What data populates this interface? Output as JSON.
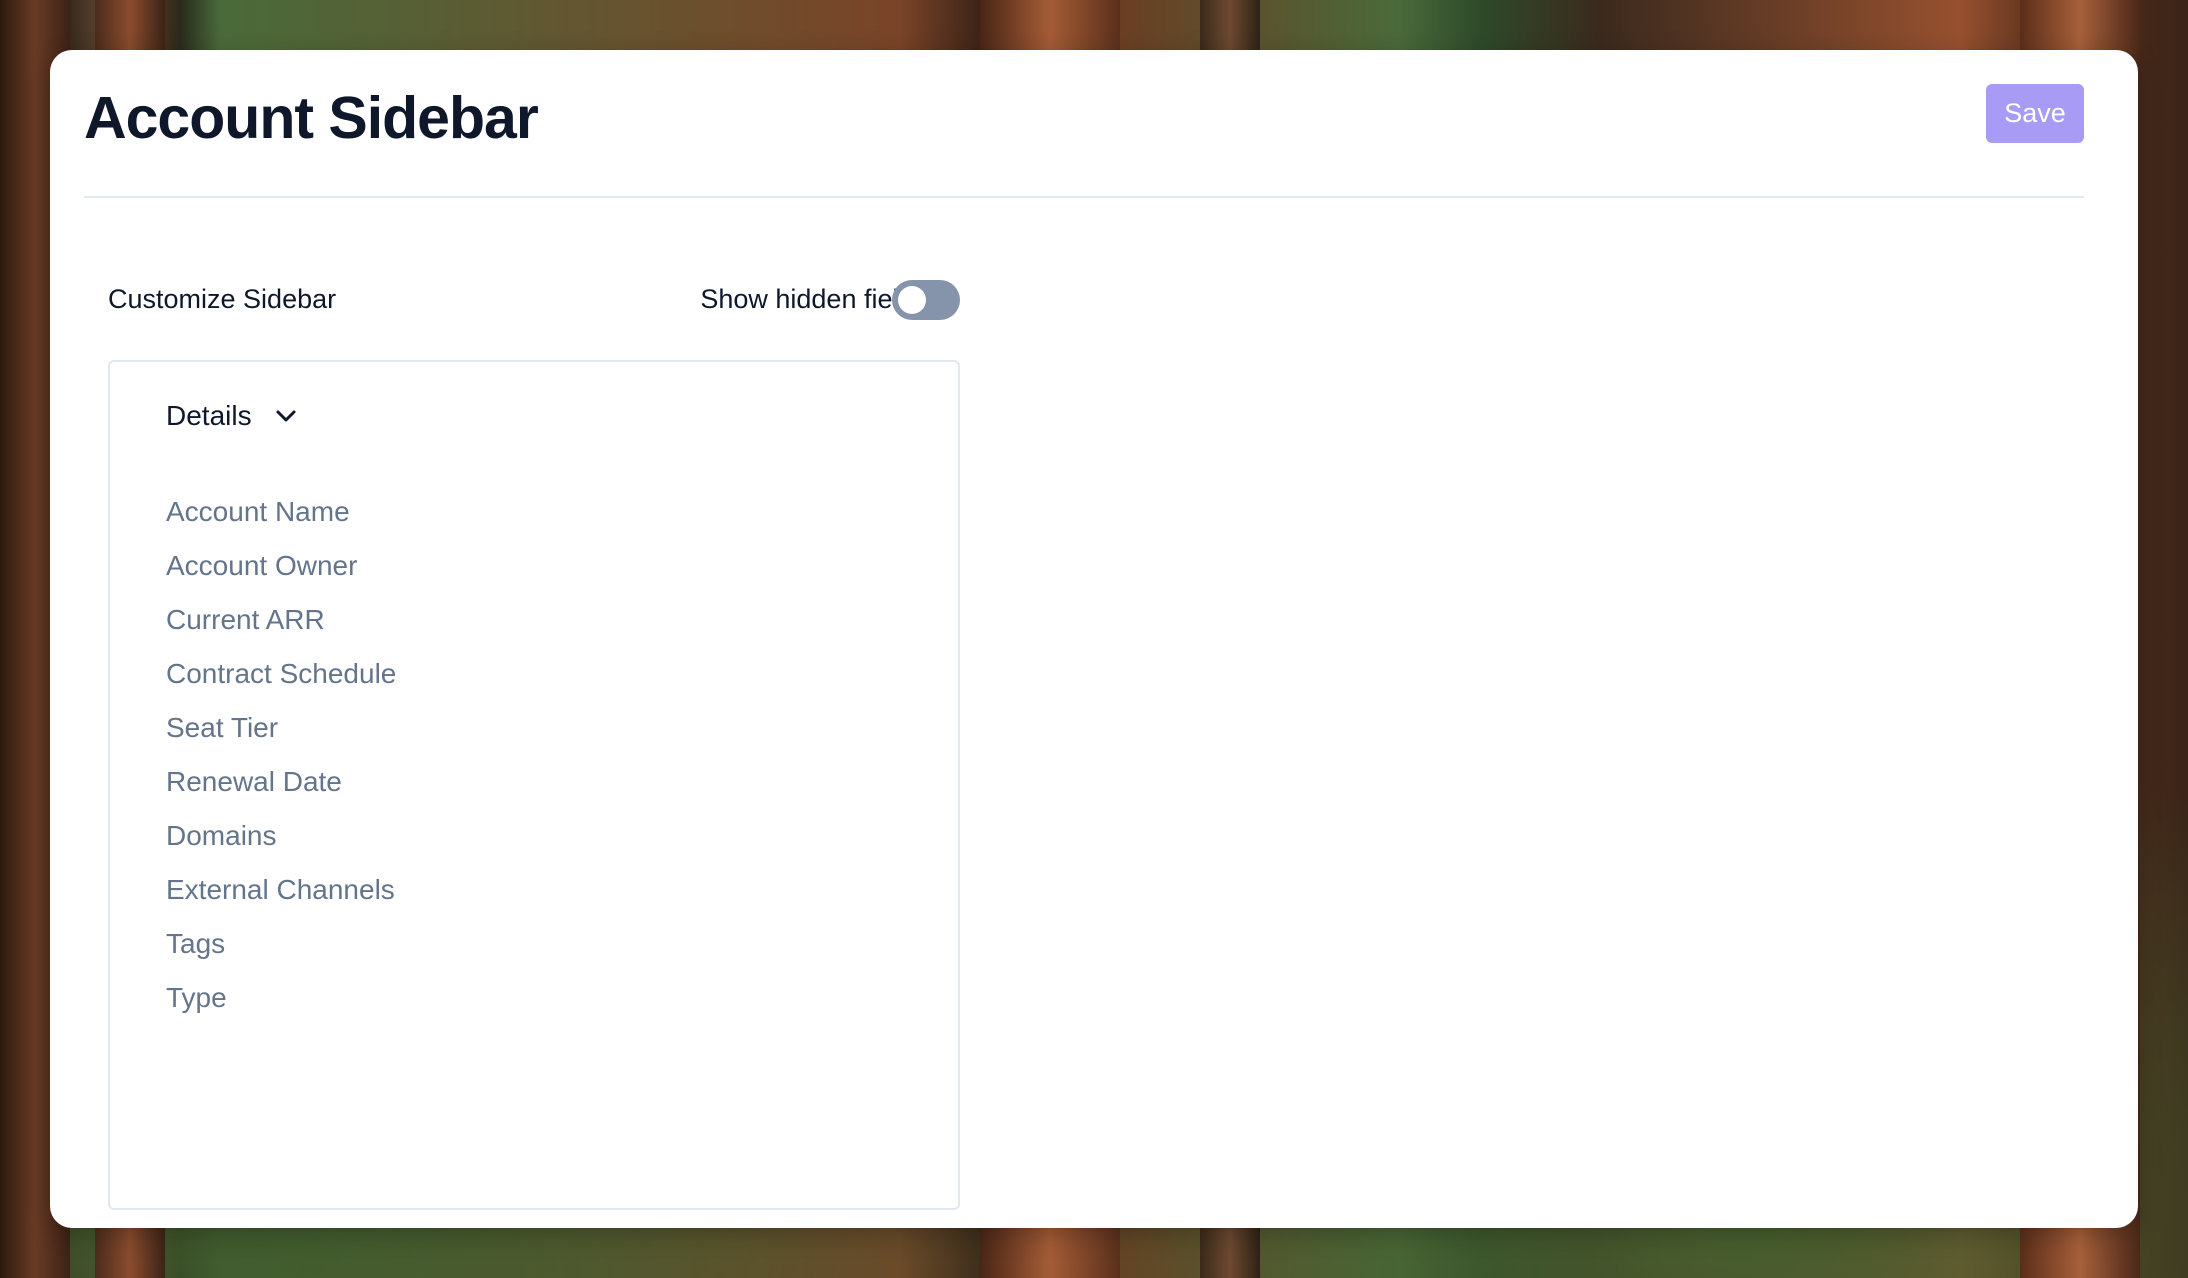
{
  "page": {
    "title": "Account Sidebar",
    "save_label": "Save"
  },
  "customize": {
    "section_label": "Customize Sidebar",
    "toggle_label": "Show hidden fields",
    "toggle_on": false
  },
  "panel": {
    "title": "Details",
    "icon": "chevron-down-icon",
    "fields": [
      "Account Name",
      "Account Owner",
      "Current ARR",
      "Contract Schedule",
      "Seat Tier",
      "Renewal Date",
      "Domains",
      "External Channels",
      "Tags",
      "Type"
    ]
  },
  "colors": {
    "accent": "#a89bf5",
    "title": "#0f172a",
    "muted": "#64748b",
    "toggle_off": "#8694ab",
    "border": "#e2e8f0"
  }
}
